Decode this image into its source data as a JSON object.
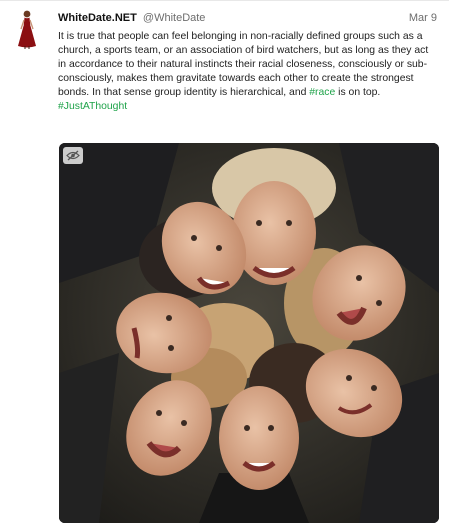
{
  "post": {
    "author": "WhiteDate.NET",
    "handle": "@WhiteDate",
    "date": "Mar 9",
    "text_part1": "It is true that people can feel belonging in non-racially defined groups such as a church, a sports team, or an association of bird watchers, but as long as they act in accordance to their natural instincts their racial closeness, consciously or sub-consciously, makes them gravitate towards each other to create the strongest bonds. In that sense group identity is hierarchical, and ",
    "hashtag_inline": "#race",
    "text_part2": " is on top.",
    "hashtag_footer": "#JustAThought"
  },
  "media": {
    "visibility_icon": "eye-slash-icon"
  },
  "colors": {
    "link": "#1fa34a",
    "avatar_dress": "#8b0f12"
  }
}
